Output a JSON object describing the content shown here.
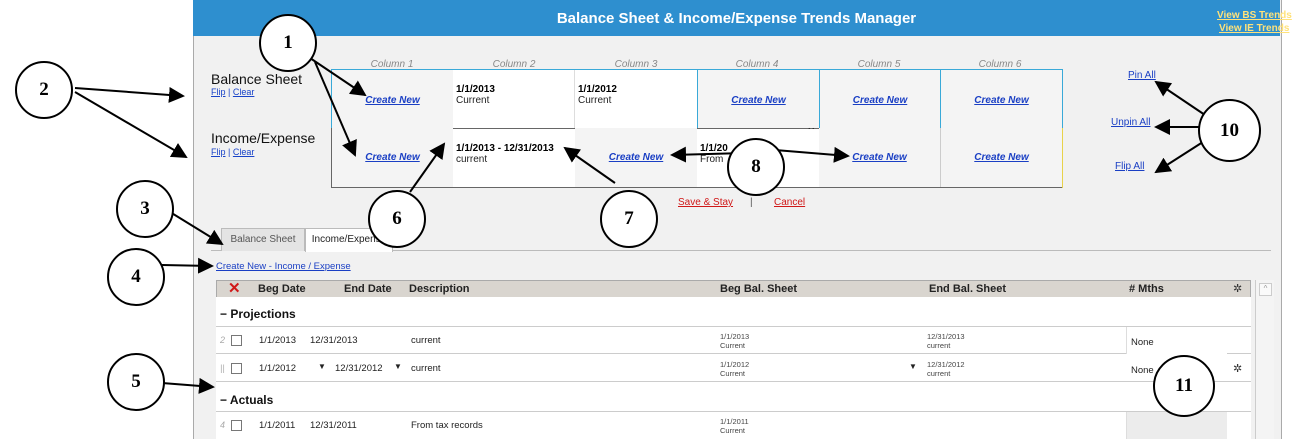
{
  "header": {
    "title": "Balance Sheet & Income/Expense Trends Manager",
    "links": [
      "View BS Trends",
      "View IE Trends"
    ]
  },
  "columns": [
    "Column 1",
    "Column 2",
    "Column 3",
    "Column 4",
    "Column 5",
    "Column 6"
  ],
  "rows": {
    "balance": {
      "label": "Balance Sheet",
      "flip": "Flip",
      "sep": "|",
      "clear": "Clear"
    },
    "income": {
      "label": "Income/Expense",
      "flip": "Flip",
      "sep": "|",
      "clear": "Clear"
    }
  },
  "cells": {
    "create_new": "Create New",
    "bs_col2": {
      "date": "1/1/2013",
      "name": "Current"
    },
    "bs_col3": {
      "date": "1/1/2012",
      "name": "Current"
    },
    "ie_col2": {
      "date": "1/1/2013 - 12/31/2013",
      "name": "current"
    },
    "ie_col4": {
      "date": "1/1/20",
      "name": "From"
    }
  },
  "right_links": {
    "pin_all": "Pin All",
    "unpin_all": "Unpin All",
    "flip_all": "Flip All"
  },
  "actions": {
    "save_stay": "Save & Stay",
    "sep": "|",
    "cancel": "Cancel"
  },
  "tabs": [
    "Balance Sheet",
    "Income/Expense"
  ],
  "create_link": "Create New - Income / Expense",
  "grid": {
    "headers": [
      "Beg Date",
      "End Date",
      "Description",
      "Beg Bal. Sheet",
      "End Bal. Sheet",
      "# Mths"
    ],
    "groups": {
      "projections": "− Projections",
      "actuals": "− Actuals"
    },
    "rows": [
      {
        "num": "2",
        "beg": "1/1/2013",
        "end": "12/31/2013",
        "desc": "current",
        "bbs_date": "1/1/2013",
        "bbs_name": "Current",
        "ebs_date": "12/31/2013",
        "ebs_name": "current",
        "mths": "None"
      },
      {
        "num": "||",
        "beg": "1/1/2012",
        "end": "12/31/2012",
        "desc": "current",
        "bbs_date": "1/1/2012",
        "bbs_name": "Current",
        "ebs_date": "12/31/2012",
        "ebs_name": "current",
        "mths": "None"
      },
      {
        "num": "4",
        "beg": "1/1/2011",
        "end": "12/31/2011",
        "desc": "From tax records",
        "bbs_date": "1/1/2011",
        "bbs_name": "Current",
        "ebs_date": "",
        "ebs_name": "",
        "mths": ""
      }
    ]
  },
  "callouts": [
    "1",
    "2",
    "3",
    "4",
    "5",
    "6",
    "7",
    "8",
    "10",
    "11"
  ],
  "colors": {
    "header_blue": "#2e8fcf",
    "link_blue": "#1a3fc4",
    "red": "#d01818",
    "link_yellow": "#ffe27a"
  }
}
